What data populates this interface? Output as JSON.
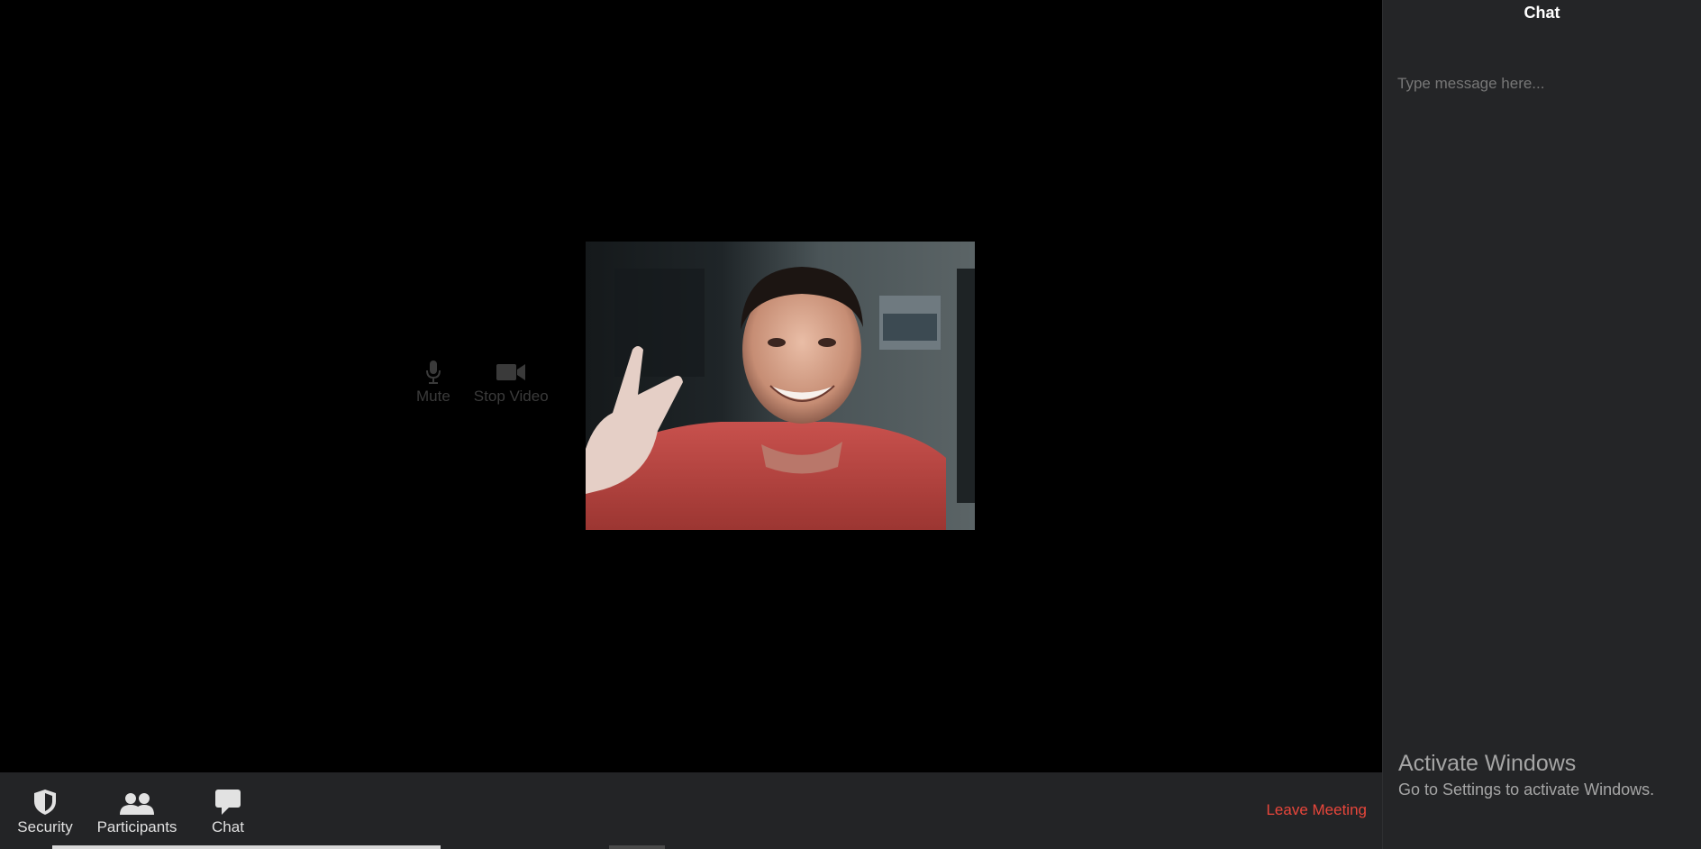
{
  "meeting": {
    "hover_controls": {
      "mute_label": "Mute",
      "stop_video_label": "Stop Video",
      "mute_icon": "microphone-icon",
      "video_icon": "video-camera-icon"
    },
    "video_tile": {
      "content": "webcam-feed"
    }
  },
  "toolbar": {
    "security_label": "Security",
    "participants_label": "Participants",
    "chat_label": "Chat",
    "leave_label": "Leave Meeting",
    "icons": {
      "security": "shield-icon",
      "participants": "people-icon",
      "chat": "speech-bubble-icon"
    },
    "colors": {
      "background": "#232426",
      "leave": "#e8463b"
    }
  },
  "chat_panel": {
    "title": "Chat",
    "input_placeholder": "Type message here..."
  },
  "watermark": {
    "title": "Activate Windows",
    "subtitle": "Go to Settings to activate Windows."
  }
}
